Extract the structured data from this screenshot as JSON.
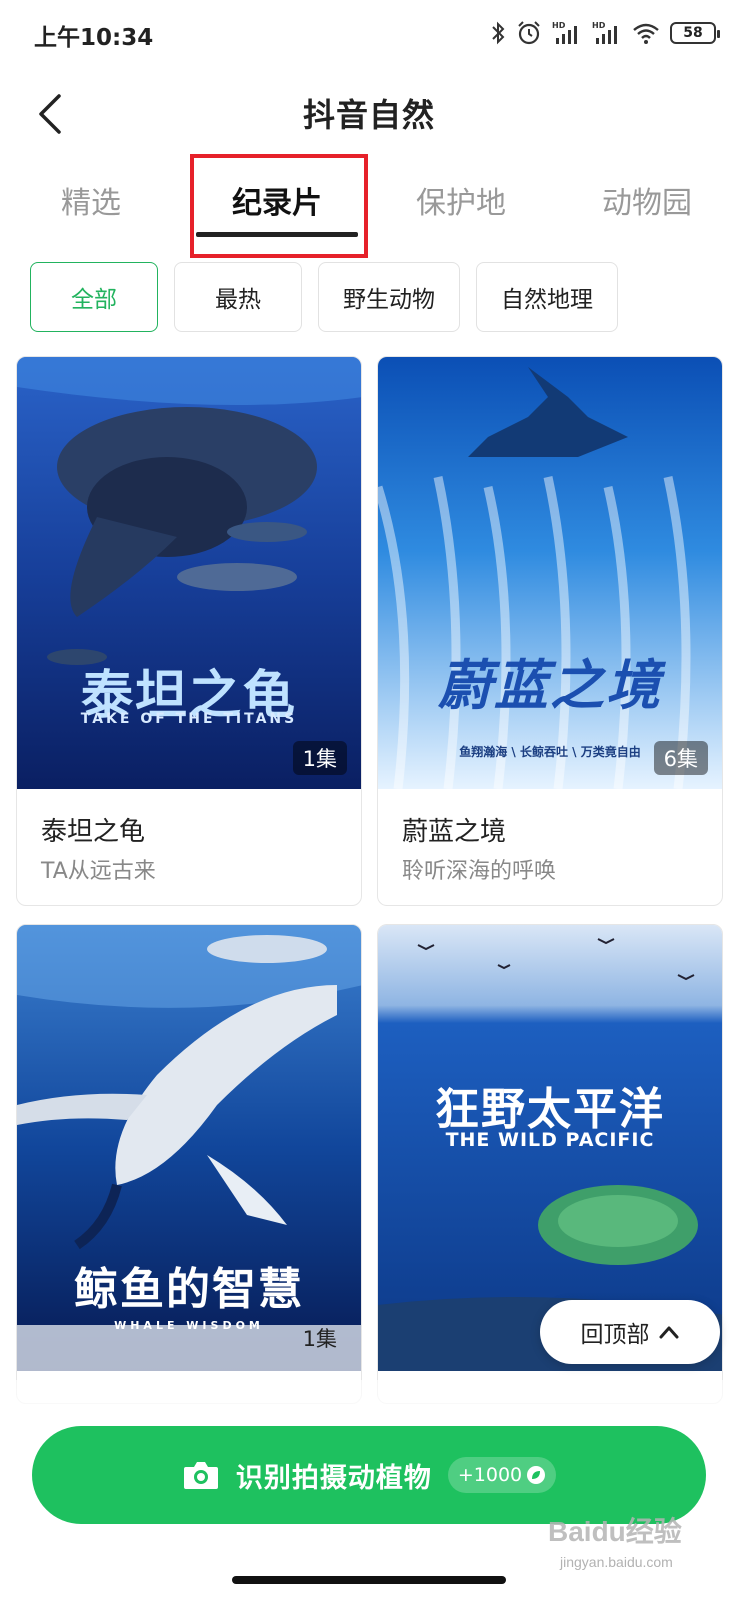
{
  "status_bar": {
    "time": "上午10:34",
    "battery": "58",
    "icons": [
      "bluetooth-icon",
      "alarm-icon",
      "hd-signal-icon",
      "hd-signal-icon",
      "wifi-icon",
      "battery-icon"
    ]
  },
  "header": {
    "title": "抖音自然",
    "back_icon": "chevron-left-icon"
  },
  "tabs": [
    {
      "label": "精选",
      "active": false
    },
    {
      "label": "纪录片",
      "active": true
    },
    {
      "label": "保护地",
      "active": false
    },
    {
      "label": "动物园",
      "active": false
    }
  ],
  "filters": [
    {
      "label": "全部",
      "active": true
    },
    {
      "label": "最热",
      "active": false
    },
    {
      "label": "野生动物",
      "active": false
    },
    {
      "label": "自然地理",
      "active": false
    }
  ],
  "cards": [
    {
      "poster_title": "泰坦之龟",
      "poster_subtitle": "TAKE OF THE TITANS",
      "episodes": "1集",
      "title": "泰坦之龟",
      "subtitle": "TA从远古来"
    },
    {
      "poster_title": "蔚蓝之境",
      "poster_subtitle": "鱼翔瀚海 \\ 长鲸吞吐 \\ 万类竟自由",
      "episodes": "6集",
      "title": "蔚蓝之境",
      "subtitle": "聆听深海的呼唤"
    },
    {
      "poster_title": "鲸鱼的智慧",
      "poster_subtitle": "WHALE WISDOM",
      "episodes": "1集",
      "title": "",
      "subtitle": ""
    },
    {
      "poster_title": "狂野太平洋",
      "poster_subtitle": "THE WILD PACIFIC",
      "episodes": "",
      "title": "",
      "subtitle": ""
    }
  ],
  "back_to_top": {
    "label": "回顶部"
  },
  "identify_button": {
    "label": "识别拍摄动植物",
    "points": "+1000"
  },
  "watermark": {
    "brand": "Baidu经验",
    "url": "jingyan.baidu.com"
  },
  "colors": {
    "accent": "#1ec15f",
    "highlight": "#e6212a"
  }
}
